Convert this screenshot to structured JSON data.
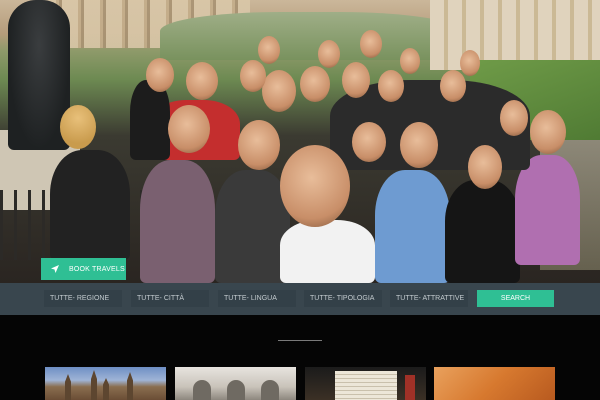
{
  "hero": {
    "image": "group-photo-on-bridge",
    "book_button": {
      "label": "BOOK TRAVELS",
      "icon": "location-arrow-icon"
    }
  },
  "filters": [
    {
      "label": "TUTTE- REGIONE"
    },
    {
      "label": "TUTTE- CITTÀ"
    },
    {
      "label": "TUTTE- LINGUA"
    },
    {
      "label": "TUTTE- TIPOLOGIA"
    },
    {
      "label": "TUTTE- ATTRATTIVE"
    }
  ],
  "search": {
    "label": "SEARCH"
  },
  "thumbnails": [
    {
      "image": "cathedral-spires-thumbnail"
    },
    {
      "image": "courtyard-arches-thumbnail"
    },
    {
      "image": "stacked-books-thumbnail"
    },
    {
      "image": "orange-abstract-thumbnail"
    }
  ],
  "colors": {
    "accent": "#2fbf94",
    "filter_bar": "#39464e",
    "background": "#050505"
  }
}
